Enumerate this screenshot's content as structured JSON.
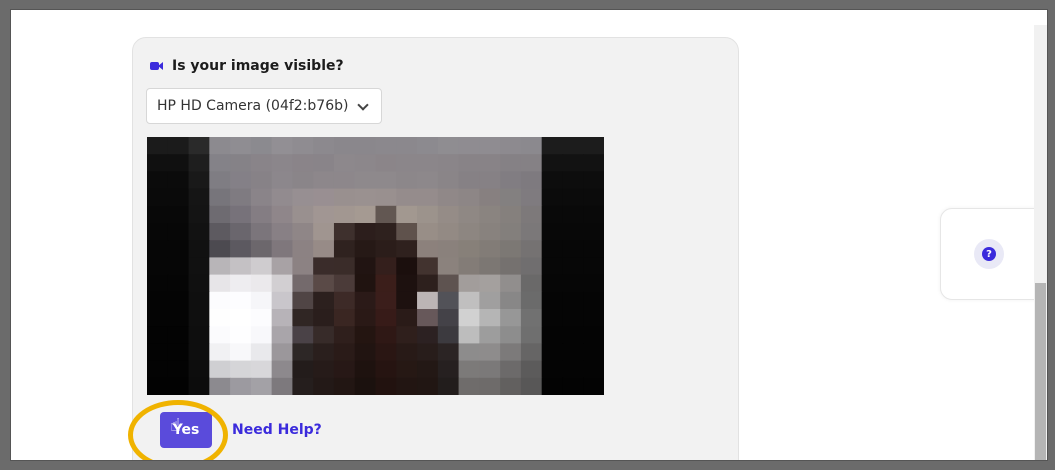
{
  "card": {
    "title": "Is your image visible?",
    "camera_icon": "video-camera-icon"
  },
  "camera_select": {
    "selected": "HP HD Camera (04f2:b76b)"
  },
  "video_preview": {
    "pixels": [
      "#1b1b1b",
      "#1b1b1b",
      "#2a2a2a",
      "#8c8a8f",
      "#8f8d92",
      "#8b8a8f",
      "#928f94",
      "#8f8c91",
      "#8c898e",
      "#8a878c",
      "#8a878c",
      "#8b888d",
      "#8b888d",
      "#8c8a8f",
      "#8f8d91",
      "#8f8c91",
      "#8f8c91",
      "#8d8a8f",
      "#8b898e",
      "#1c1c1c",
      "#1c1c1c",
      "#1c1c1c",
      "#101010",
      "#101010",
      "#1e1e1e",
      "#848288",
      "#858287",
      "#898489",
      "#8b868b",
      "#8a8489",
      "#898489",
      "#8d888c",
      "#8c878b",
      "#8b8589",
      "#8b868a",
      "#8b868a",
      "#8a8589",
      "#888387",
      "#888387",
      "#858185",
      "#858185",
      "#121212",
      "#121212",
      "#121212",
      "#0b0b0b",
      "#0b0b0b",
      "#191919",
      "#7f7d83",
      "#848087",
      "#878287",
      "#8c878c",
      "#8a8589",
      "#8d878b",
      "#8d878b",
      "#8e898c",
      "#8e898c",
      "#8c878a",
      "#8d888b",
      "#8a8588",
      "#868185",
      "#868185",
      "#817d82",
      "#7e7a7f",
      "#0d0d0d",
      "#0d0d0d",
      "#0d0d0d",
      "#0a0a0a",
      "#0a0a0a",
      "#151515",
      "#77757b",
      "#7f7b81",
      "#8a8489",
      "#928b8f",
      "#978f92",
      "#998f92",
      "#99908f",
      "#9a9190",
      "#99908f",
      "#958c8c",
      "#958c8c",
      "#908888",
      "#8d8686",
      "#878080",
      "#838080",
      "#7f7b7f",
      "#0b0b0b",
      "#0b0b0b",
      "#0b0b0b",
      "#080808",
      "#080808",
      "#141414",
      "#6e6b71",
      "#77727a",
      "#847d83",
      "#8f868a",
      "#99908f",
      "#a19693",
      "#a29791",
      "#a59a92",
      "#625752",
      "#a29890",
      "#9c938c",
      "#958c87",
      "#8f8884",
      "#8a8480",
      "#85807d",
      "#7d797a",
      "#090909",
      "#090909",
      "#090909",
      "#070707",
      "#070707",
      "#121212",
      "#5d5a60",
      "#6a666d",
      "#7b757b",
      "#888085",
      "#8f8687",
      "#a09590",
      "#3e302d",
      "#2c1e1c",
      "#2e211e",
      "#5f524c",
      "#988e87",
      "#938a84",
      "#8d8681",
      "#88827e",
      "#837f7c",
      "#7b7879",
      "#080808",
      "#080808",
      "#080808",
      "#060606",
      "#060606",
      "#111111",
      "#4c4a50",
      "#5c5960",
      "#6c676c",
      "#7f777c",
      "#8c8283",
      "#978b87",
      "#2f221f",
      "#261916",
      "#2b1d1a",
      "#2f211e",
      "#8c817c",
      "#8a817c",
      "#878079",
      "#827c77",
      "#7c7874",
      "#757272",
      "#070707",
      "#070707",
      "#070707",
      "#060606",
      "#060606",
      "#111111",
      "#b8b5b8",
      "#c4c1c4",
      "#cfcccf",
      "#a8a2a5",
      "#8c8283",
      "#3a2c2a",
      "#3a2c29",
      "#211412",
      "#341f1c",
      "#1b0f0d",
      "#42332f",
      "#8b827d",
      "#837c77",
      "#7c7773",
      "#75716f",
      "#706e6f",
      "#070707",
      "#070707",
      "#070707",
      "#050505",
      "#050505",
      "#101010",
      "#e7e5e8",
      "#eeedf0",
      "#ebe9ec",
      "#d2cfd2",
      "#746a6c",
      "#5a4a47",
      "#4b3b39",
      "#201310",
      "#3b1e1a",
      "#1d110f",
      "#2d201d",
      "#5e5350",
      "#a29d9b",
      "#a4a09e",
      "#918e8d",
      "#6a6969",
      "#060606",
      "#060606",
      "#060606",
      "#040404",
      "#040404",
      "#0f0f0f",
      "#fcfcfe",
      "#fdfdff",
      "#f6f6f9",
      "#c9c6cb",
      "#504545",
      "#2c201e",
      "#3d2a27",
      "#2b1a18",
      "#3b1e1b",
      "#1d110f",
      "#bcb5b5",
      "#525258",
      "#c0bfbf",
      "#a09f9f",
      "#888787",
      "#6b6b6b",
      "#050505",
      "#050505",
      "#050505",
      "#040404",
      "#040404",
      "#0f0f0f",
      "#fefefe",
      "#ffffff",
      "#fcfcfe",
      "#b7b3b8",
      "#302624",
      "#2a1e1c",
      "#3a2622",
      "#2a1916",
      "#371b18",
      "#2a1b18",
      "#67585a",
      "#444248",
      "#d1d1d1",
      "#b5b5b5",
      "#979797",
      "#717171",
      "#050505",
      "#050505",
      "#050505",
      "#030303",
      "#030303",
      "#0e0e0e",
      "#fbfbfd",
      "#fefeff",
      "#f8f8fb",
      "#a9a5aa",
      "#4a4247",
      "#372b29",
      "#2f1f1c",
      "#241511",
      "#2f1815",
      "#2f1f1c",
      "#2c2122",
      "#3c3a3f",
      "#bdbdbd",
      "#9d9d9d",
      "#8d8d8d",
      "#6f6f6f",
      "#040404",
      "#040404",
      "#040404",
      "#030303",
      "#030303",
      "#0e0e0e",
      "#f1f1f3",
      "#f8f8fa",
      "#e9e9ec",
      "#9b979b",
      "#2d2726",
      "#2a1f1d",
      "#2a1b18",
      "#211411",
      "#2a1613",
      "#281a17",
      "#281d1b",
      "#2b2424",
      "#8d8c8c",
      "#8e8c8c",
      "#7c7a7a",
      "#666565",
      "#040404",
      "#040404",
      "#040404",
      "#030303",
      "#030303",
      "#0d0d0d",
      "#cfcfd2",
      "#d5d5d8",
      "#d8d7da",
      "#8d898d",
      "#231c1b",
      "#261b19",
      "#271816",
      "#1e120f",
      "#261411",
      "#261814",
      "#231815",
      "#262020",
      "#7c7a79",
      "#7b7979",
      "#6c6a6a",
      "#5c5b5b",
      "#040404",
      "#040404",
      "#040404",
      "#020202",
      "#020202",
      "#0c0c0c",
      "#8c8a8f",
      "#9c9aa0",
      "#a3a1a6",
      "#7d797d",
      "#251e1d",
      "#231917",
      "#221613",
      "#1b110e",
      "#22120f",
      "#221512",
      "#211613",
      "#221d1c",
      "#6f6c6b",
      "#6e6b6a",
      "#62605f",
      "#585757",
      "#030303",
      "#030303",
      "#030303"
    ],
    "cols": 22,
    "rows": 15
  },
  "actions": {
    "yes_label": "Yes",
    "help_label": "Need Help?"
  },
  "side_panel": {
    "icon": "question-circle-icon"
  },
  "colors": {
    "accent": "#3b2bdc",
    "button": "#5a4bdb",
    "highlight": "#f0b300"
  }
}
